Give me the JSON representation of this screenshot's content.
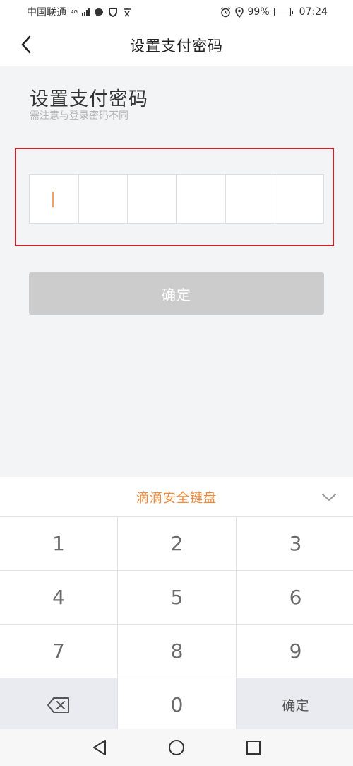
{
  "status_bar": {
    "carrier": "中国联通",
    "network": "4G",
    "battery": "99%",
    "time": "07:24"
  },
  "nav": {
    "title": "设置支付密码"
  },
  "content": {
    "heading": "设置支付密码",
    "subheading": "需注意与登录密码不同",
    "pin_length": 6,
    "confirm_label": "确定"
  },
  "keyboard": {
    "title": "滴滴安全键盘",
    "keys": [
      "1",
      "2",
      "3",
      "4",
      "5",
      "6",
      "7",
      "8",
      "9"
    ],
    "zero": "0",
    "confirm_label": "确定"
  },
  "colors": {
    "accent": "#f08a3c",
    "highlight": "#c8222a",
    "disabled_button": "#cccccc"
  }
}
